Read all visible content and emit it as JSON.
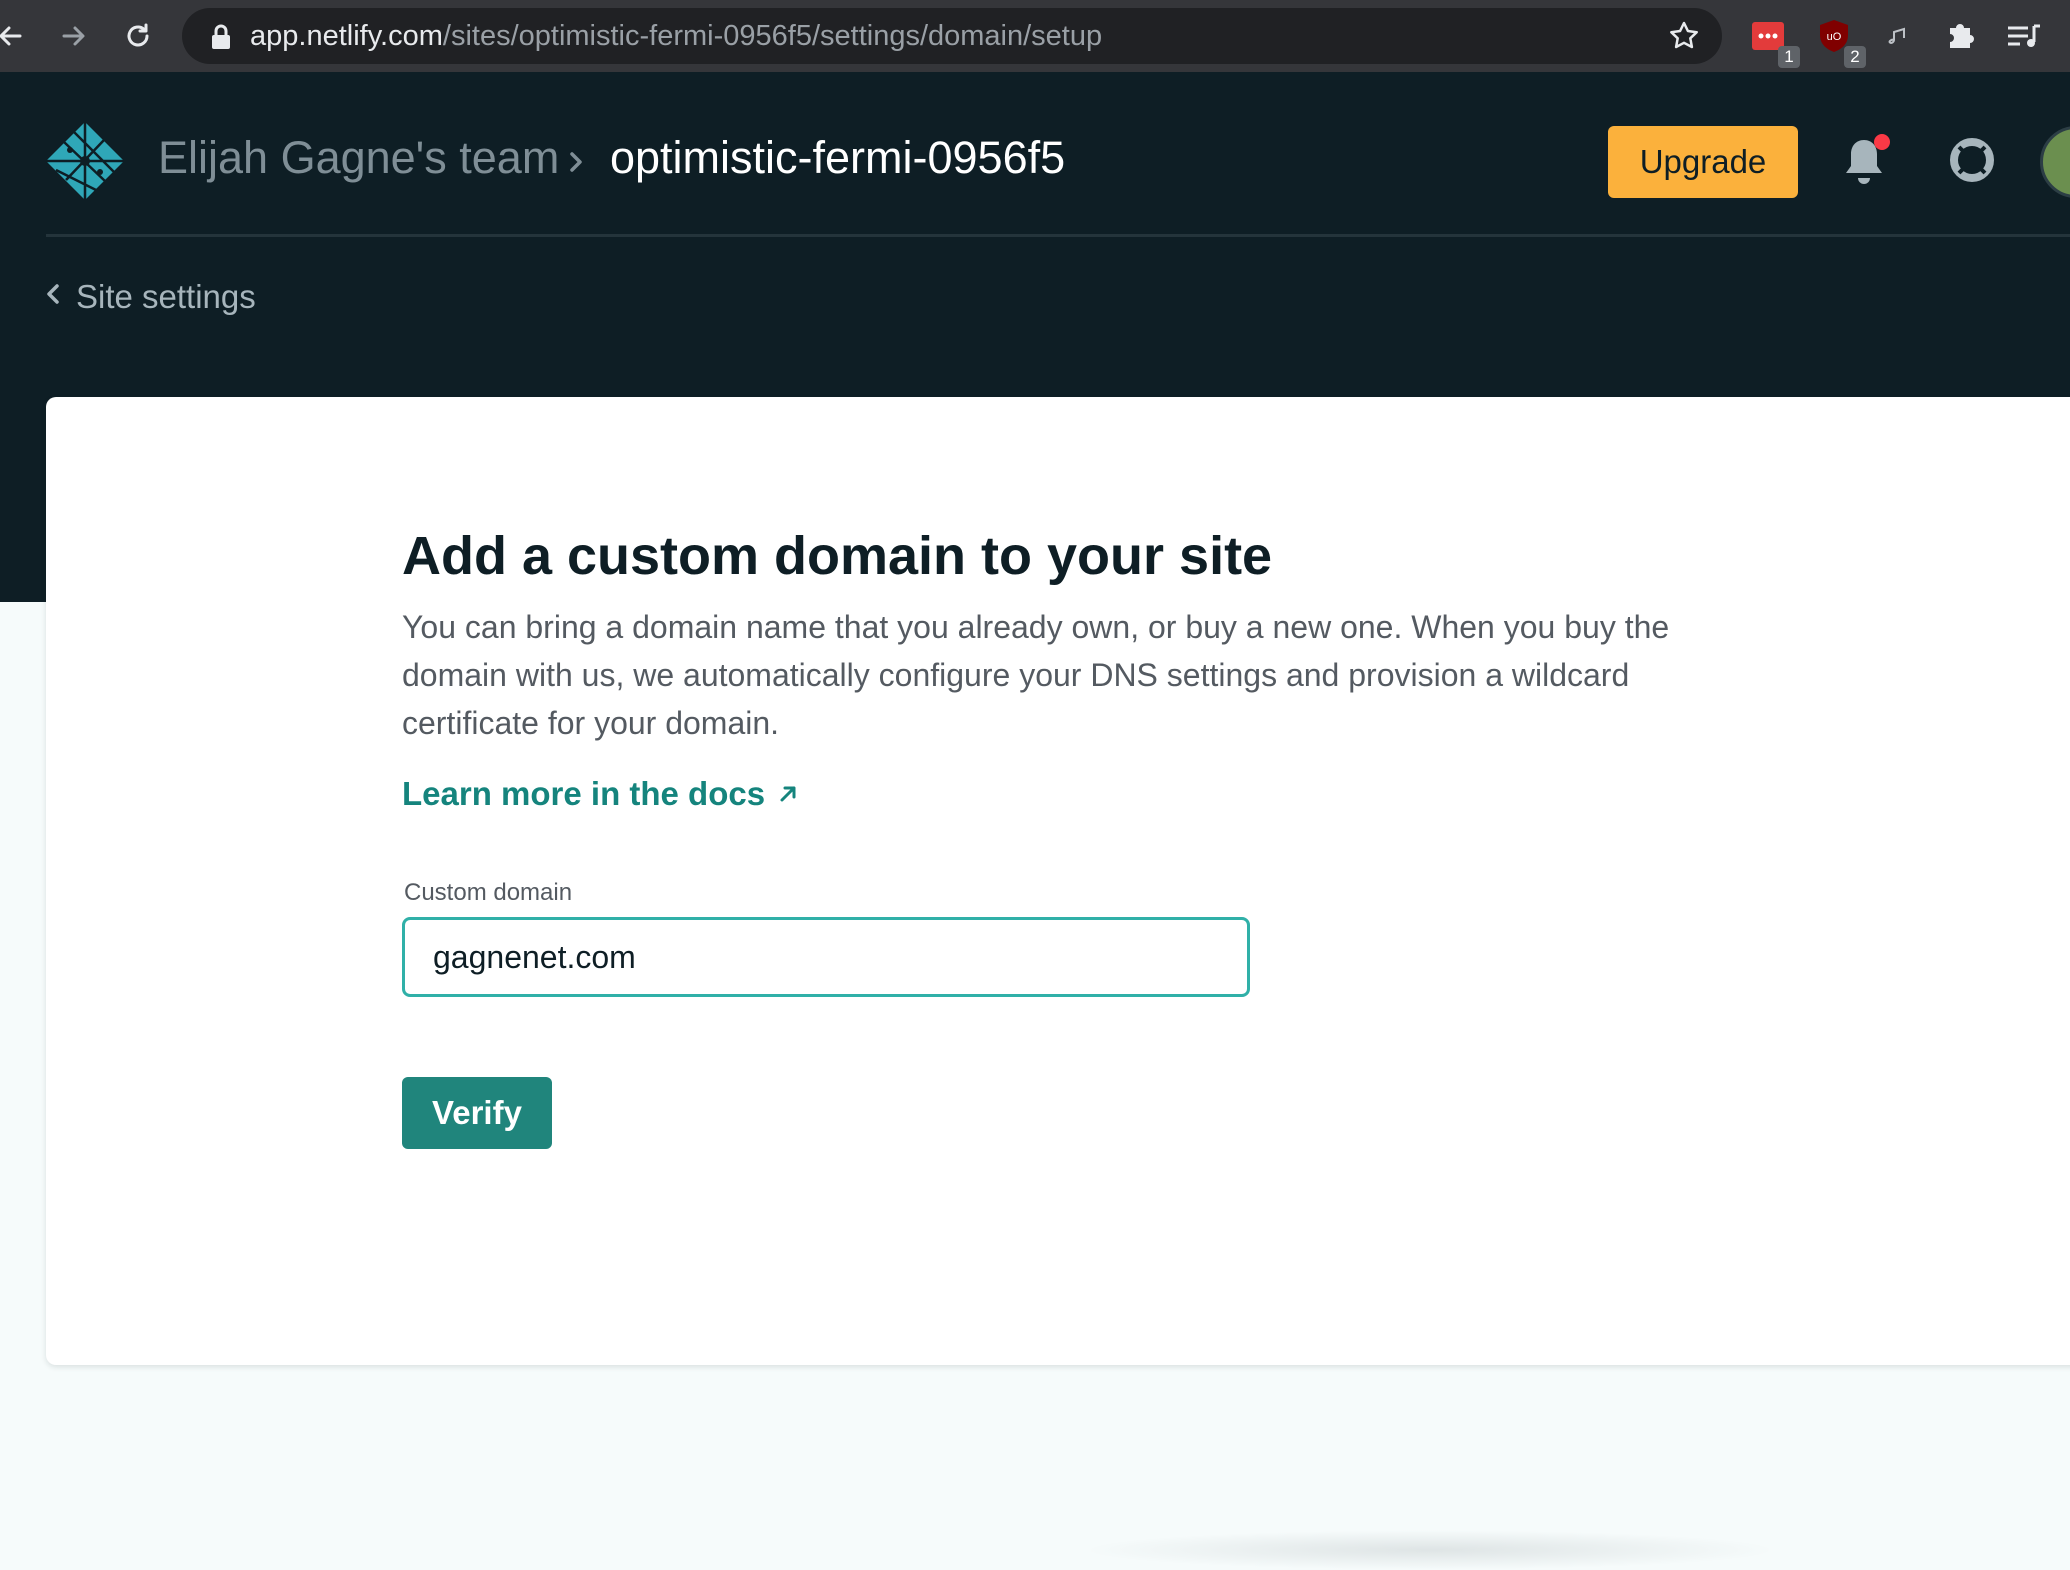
{
  "browser": {
    "url_host": "app.netlify.com",
    "url_path": "/sites/optimistic-fermi-0956f5/settings/domain/setup",
    "extensions": [
      {
        "name": "ext-red-icon",
        "badge": "1"
      },
      {
        "name": "ublock-icon",
        "badge": "2"
      }
    ]
  },
  "header": {
    "team_name": "Elijah Gagne's team",
    "site_name": "optimistic-fermi-0956f5",
    "upgrade_label": "Upgrade",
    "back_label": "Site settings"
  },
  "main": {
    "title": "Add a custom domain to your site",
    "description": "You can bring a domain name that you already own, or buy a new one. When you buy the domain with us, we automatically configure your DNS settings and provision a wildcard certificate for your domain.",
    "docs_link": "Learn more in the docs",
    "field_label": "Custom domain",
    "field_value": "gagnenet.com",
    "verify_label": "Verify"
  },
  "colors": {
    "header_bg": "#0e1e25",
    "upgrade": "#fbb13c",
    "accent": "#20857c",
    "link": "#15847d",
    "input_border": "#30b0a8"
  }
}
